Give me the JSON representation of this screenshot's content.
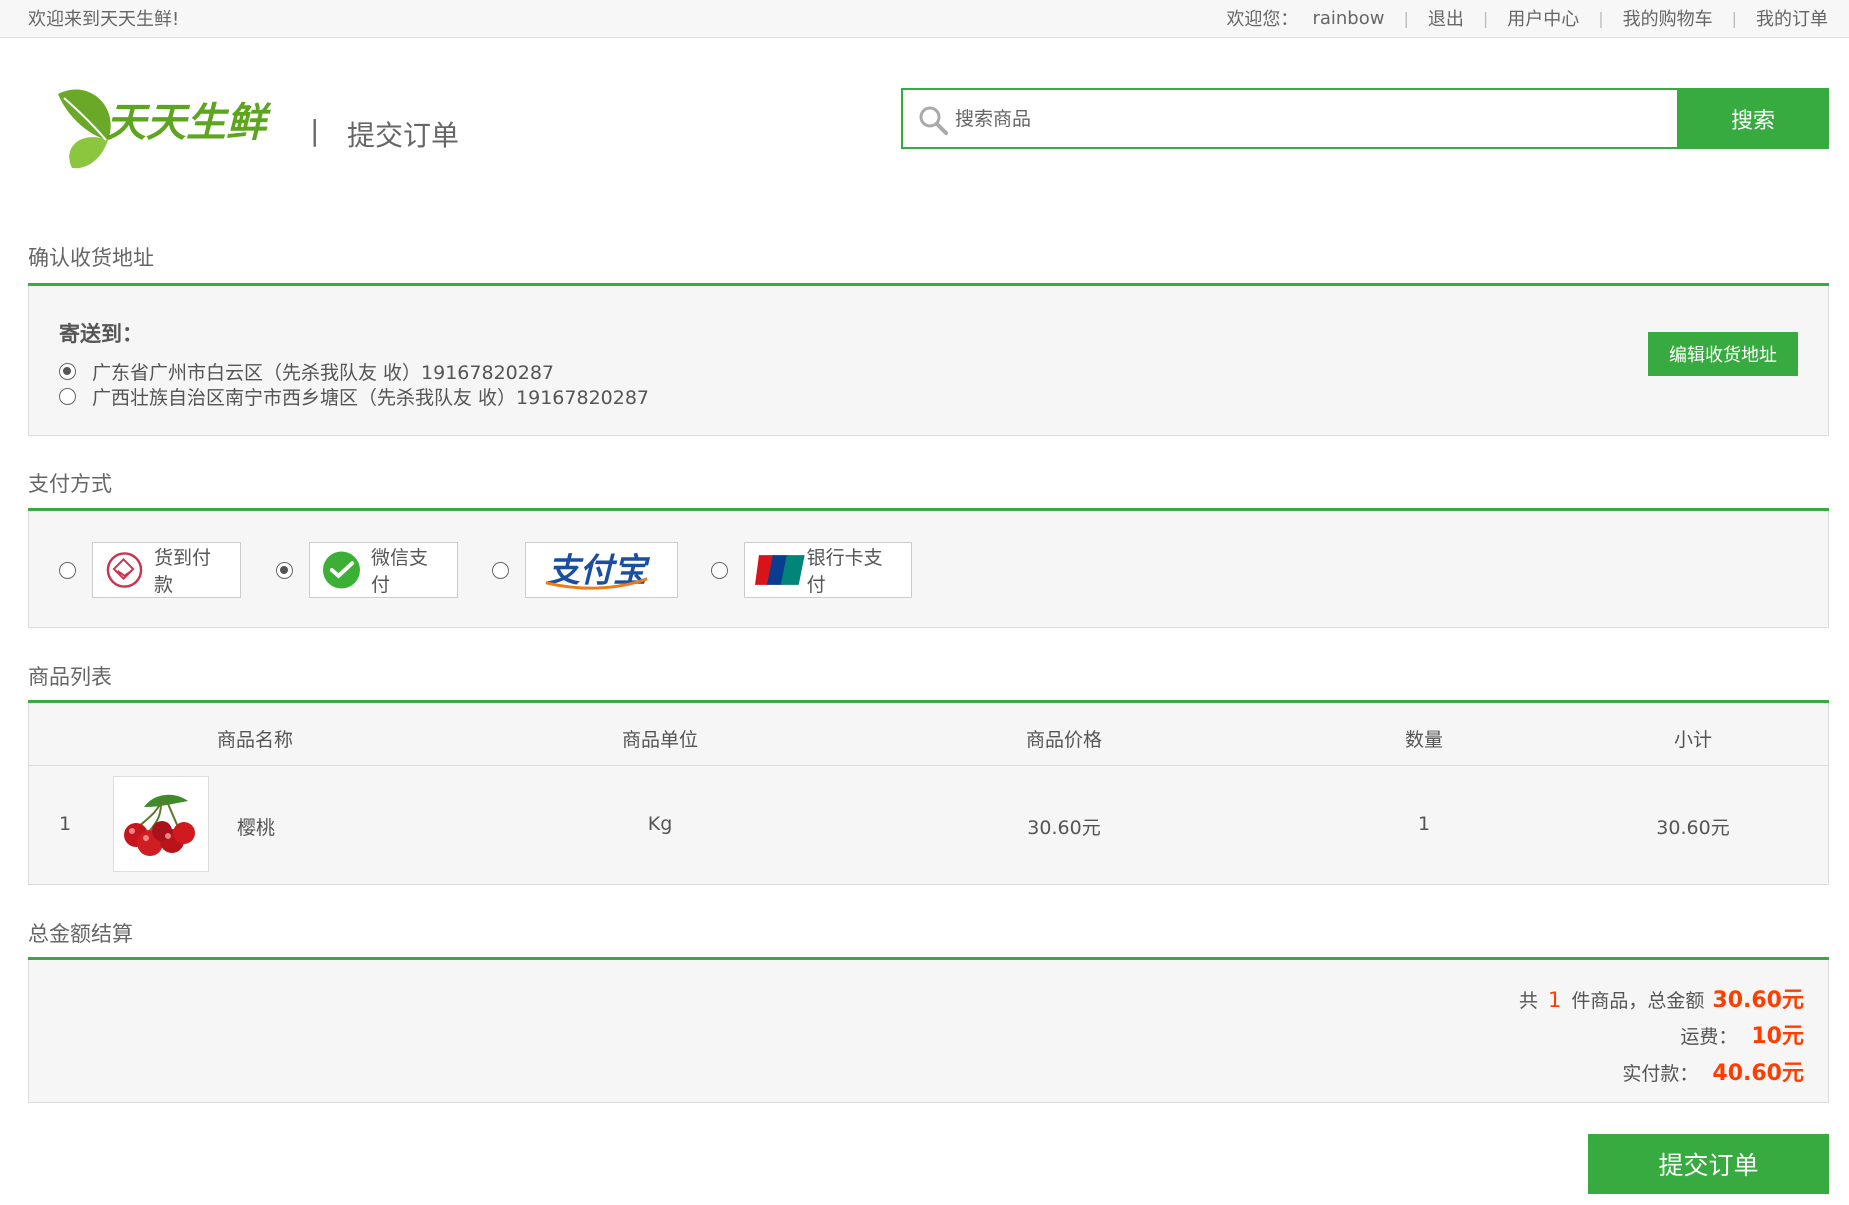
{
  "topbar": {
    "welcome": "欢迎来到天天生鲜!",
    "greeting": "欢迎您：",
    "username": "rainbow",
    "logout": "退出",
    "user_center": "用户中心",
    "cart": "我的购物车",
    "orders": "我的订单"
  },
  "header": {
    "logo_text": "天天生鲜",
    "separator": "|",
    "page_title": "提交订单",
    "search_placeholder": "搜索商品",
    "search_button": "搜索"
  },
  "address": {
    "section_title": "确认收货地址",
    "label": "寄送到：",
    "items": [
      {
        "text": "广东省广州市白云区（先杀我队友 收）19167820287",
        "checked": true
      },
      {
        "text": "广西壮族自治区南宁市西乡塘区（先杀我队友 收）19167820287",
        "checked": false
      }
    ],
    "edit_button": "编辑收货地址"
  },
  "payment": {
    "section_title": "支付方式",
    "options": [
      {
        "label": "货到付款",
        "icon": "cod-icon",
        "checked": false
      },
      {
        "label": "微信支付",
        "icon": "wechat-pay-icon",
        "checked": true
      },
      {
        "label": "支付宝",
        "icon": "alipay-logo",
        "checked": false
      },
      {
        "label": "银行卡支付",
        "icon": "unionpay-icon",
        "checked": false
      }
    ]
  },
  "goods": {
    "section_title": "商品列表",
    "headers": [
      "商品名称",
      "商品单位",
      "商品价格",
      "数量",
      "小计"
    ],
    "rows": [
      {
        "index": "1",
        "name": "樱桃",
        "unit": "Kg",
        "price": "30.60元",
        "quantity": "1",
        "subtotal": "30.60元",
        "image": "cherry-image"
      }
    ]
  },
  "totals": {
    "section_title": "总金额结算",
    "count_prefix": "共",
    "count": "1",
    "count_suffix": "件商品，总金额",
    "goods_total": "30.60元",
    "shipping_label": "运费：",
    "shipping": "10元",
    "actual_label": "实付款：",
    "actual": "40.60元"
  },
  "submit_button": "提交订单",
  "colors": {
    "accent": "#37ab40",
    "price": "#ff3d00"
  }
}
